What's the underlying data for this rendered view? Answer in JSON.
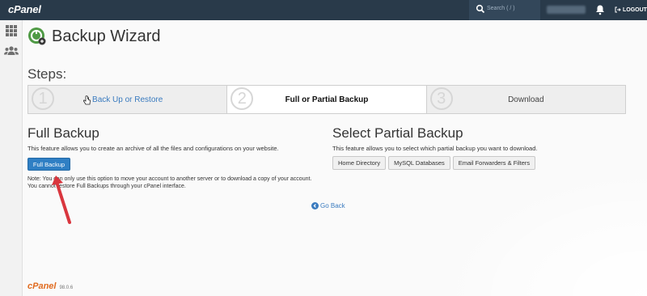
{
  "topbar": {
    "logo": "cPanel",
    "search_placeholder": "Search ( / )",
    "logout_label": "LOGOUT"
  },
  "page": {
    "title": "Backup Wizard",
    "steps_label": "Steps:"
  },
  "steps": [
    {
      "number": "1",
      "label": "Back Up or Restore"
    },
    {
      "number": "2",
      "label": "Full or Partial Backup"
    },
    {
      "number": "3",
      "label": "Download"
    }
  ],
  "full_backup": {
    "heading": "Full Backup",
    "description": "This feature allows you to create an archive of all the files and configurations on your website.",
    "button_label": "Full Backup",
    "note": "Note: You can only use this option to move your account to another server or to download a copy of your account. You cannot restore Full Backups through your cPanel interface."
  },
  "partial_backup": {
    "heading": "Select Partial Backup",
    "description": "This feature allows you to select which partial backup you want to download.",
    "buttons": [
      "Home Directory",
      "MySQL Databases",
      "Email Forwarders & Filters"
    ]
  },
  "go_back_label": "Go Back",
  "footer": {
    "logo": "cPanel",
    "version": "98.0.6"
  },
  "colors": {
    "topbar": "#293a4a",
    "accent": "#2f7fc4",
    "link": "#3a7bbf",
    "arrow": "#d9363e",
    "footer_logo": "#e06b1f"
  }
}
